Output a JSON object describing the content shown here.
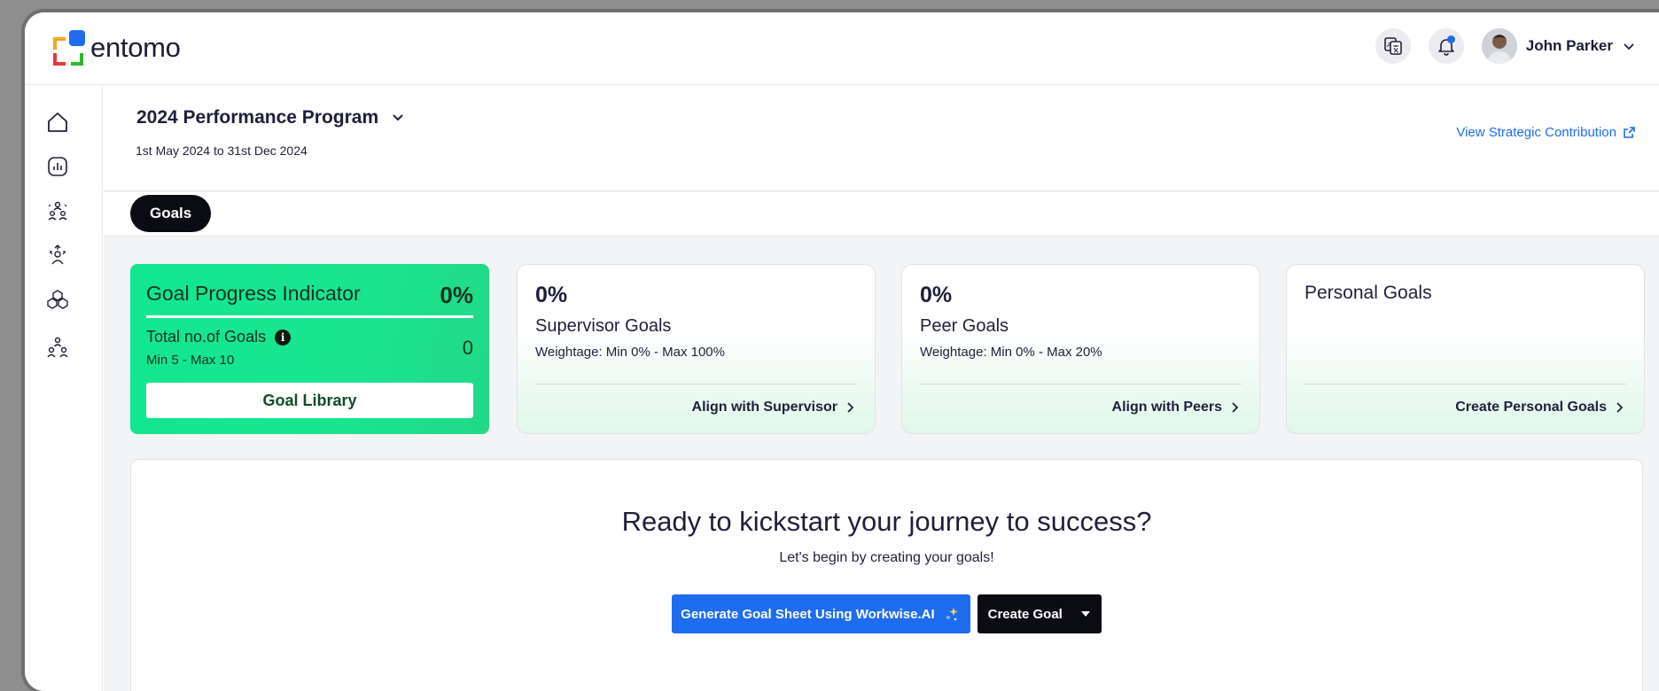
{
  "brand": {
    "name": "entomo"
  },
  "user": {
    "name": "John Parker"
  },
  "program": {
    "title": "2024 Performance Program",
    "dates": "1st May 2024 to 31st Dec 2024",
    "strategic_link": "View Strategic Contribution"
  },
  "tabs": [
    {
      "label": "Goals",
      "active": true
    }
  ],
  "progress_indicator": {
    "title": "Goal Progress Indicator",
    "percent": "0%",
    "total_label": "Total no.of Goals",
    "total_value": "0",
    "min_max": "Min 5 - Max 10",
    "library_button": "Goal Library"
  },
  "goal_cards": [
    {
      "percent": "0%",
      "title": "Supervisor Goals",
      "weightage": "Weightage: Min 0% - Max 100%",
      "action": "Align with Supervisor"
    },
    {
      "percent": "0%",
      "title": "Peer Goals",
      "weightage": "Weightage: Min 0% - Max 20%",
      "action": "Align with Peers"
    },
    {
      "title": "Personal Goals",
      "action": "Create Personal Goals"
    }
  ],
  "kickstart": {
    "title": "Ready to kickstart your journey to success?",
    "subtitle": "Let's begin by creating your goals!",
    "ai_button": "Generate Goal Sheet Using Workwise.AI",
    "create_button": "Create Goal"
  },
  "colors": {
    "accent": "#1e6cf0",
    "progress_green": "#12e691",
    "dark": "#0b0b14"
  },
  "icons": {
    "nav": [
      "home-icon",
      "reports-icon",
      "team-icon",
      "org-icon",
      "cubes-icon",
      "hierarchy-icon"
    ],
    "top": [
      "translate-icon",
      "bell-icon",
      "avatar"
    ]
  }
}
